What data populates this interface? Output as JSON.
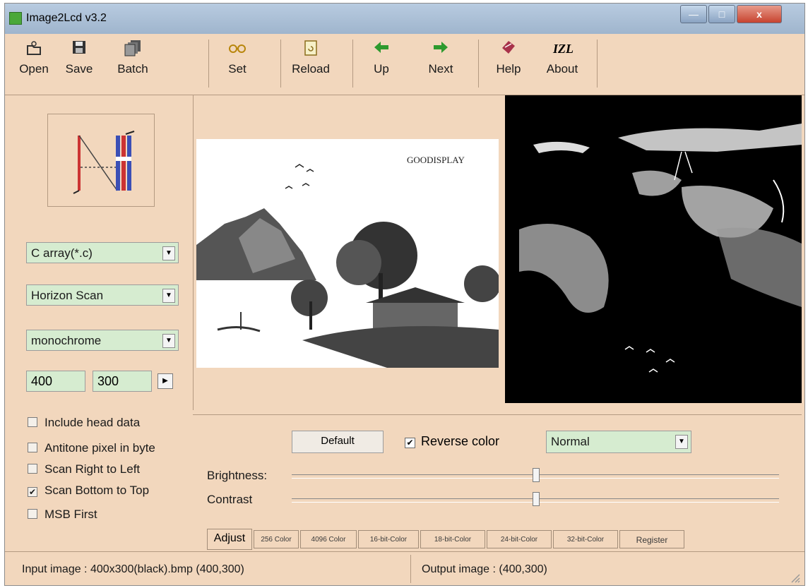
{
  "window": {
    "title": "Image2Lcd v3.2"
  },
  "toolbar": {
    "items": [
      {
        "label": "Open",
        "icon": "open-folder-icon"
      },
      {
        "label": "Save",
        "icon": "floppy-disk-icon"
      },
      {
        "label": "Batch",
        "icon": "batch-files-icon"
      },
      {
        "label": "Set",
        "icon": "settings-glasses-icon"
      },
      {
        "label": "Reload",
        "icon": "reload-page-icon"
      },
      {
        "label": "Up",
        "icon": "arrow-left-icon"
      },
      {
        "label": "Next",
        "icon": "arrow-right-icon"
      },
      {
        "label": "Help",
        "icon": "help-book-icon"
      },
      {
        "label": "About",
        "icon": "about-izl-icon"
      }
    ],
    "about_glyph": "IZL"
  },
  "left": {
    "output_type": "C array(*.c)",
    "scan_mode": "Horizon Scan",
    "color_depth": "monochrome",
    "width": "400",
    "height": "300",
    "options": [
      {
        "label": "Include head data",
        "checked": false
      },
      {
        "label": "Antitone pixel in byte",
        "checked": false
      },
      {
        "label": "Scan Right to Left",
        "checked": false
      },
      {
        "label": "Scan Bottom to Top",
        "checked": true
      },
      {
        "label": "MSB First",
        "checked": false
      }
    ]
  },
  "input_image": {
    "brand_text": "GOODISPLAY"
  },
  "adjust": {
    "default_label": "Default",
    "reverse_label": "Reverse color",
    "reverse_checked": true,
    "mode": "Normal",
    "brightness_label": "Brightness:",
    "contrast_label": "Contrast",
    "brightness_level": 0.5,
    "contrast_level": 0.5
  },
  "tabs": [
    "Adjust",
    "256 Color",
    "4096 Color",
    "16-bit-Color",
    "18-bit-Color",
    "24-bit-Color",
    "32-bit-Color",
    "Register"
  ],
  "status": {
    "input": "Input image : 400x300(black).bmp (400,300)",
    "output": "Output image :  (400,300)"
  },
  "colors": {
    "panel": "#f2d7bd",
    "field": "#d6ecd0",
    "accent_arrow": "#2e9a2e"
  }
}
